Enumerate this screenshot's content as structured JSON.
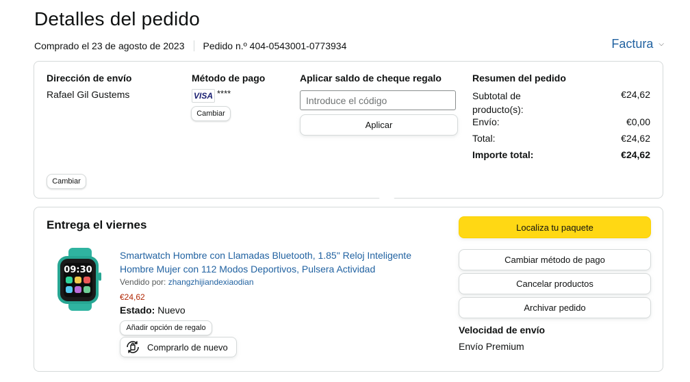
{
  "header": {
    "title": "Detalles del pedido",
    "purchase_date": "Comprado el 23 de agosto de 2023",
    "order_number": "Pedido n.º 404-0543001-0773934",
    "invoice_label": "Factura"
  },
  "shipping": {
    "heading": "Dirección de envío",
    "name": "Rafael Gil Gustems",
    "change_label": "Cambiar"
  },
  "payment": {
    "heading": "Método de pago",
    "card_brand": "VISA",
    "card_masked": "****",
    "change_label": "Cambiar"
  },
  "gift": {
    "heading": "Aplicar saldo de cheque regalo",
    "placeholder": "Introduce el código",
    "apply_label": "Aplicar"
  },
  "summary": {
    "heading": "Resumen del pedido",
    "subtotal_label": "Subtotal de producto(s):",
    "subtotal_value": "€24,62",
    "shipping_label": "Envío:",
    "shipping_value": "€0,00",
    "total_label": "Total:",
    "total_value": "€24,62",
    "grand_total_label": "Importe total:",
    "grand_total_value": "€24,62"
  },
  "delivery": {
    "heading": "Entrega el viernes",
    "product_title": "Smartwatch Hombre con Llamadas Bluetooth, 1.85\" Reloj Inteligente Hombre Mujer con 112 Modos Deportivos, Pulsera Actividad",
    "sold_by_label": "Vendido por:",
    "seller": "zhangzhijiandexiaodian",
    "price": "€24,62",
    "condition_label": "Estado:",
    "condition_value": "Nuevo",
    "gift_option_label": "Añadir opción de regalo",
    "buy_again_label": "Comprarlo de nuevo",
    "watch_time": "09:30"
  },
  "actions": {
    "track": "Localiza tu paquete",
    "change_payment": "Cambiar método de pago",
    "cancel": "Cancelar productos",
    "archive": "Archivar pedido"
  },
  "speed": {
    "heading": "Velocidad de envío",
    "value": "Envío Premium"
  },
  "colors": {
    "link": "#2162a1",
    "price": "#b12704",
    "primary_button": "#ffd814",
    "border": "#d5d9d9",
    "watch_band": "#2fb3a0"
  }
}
